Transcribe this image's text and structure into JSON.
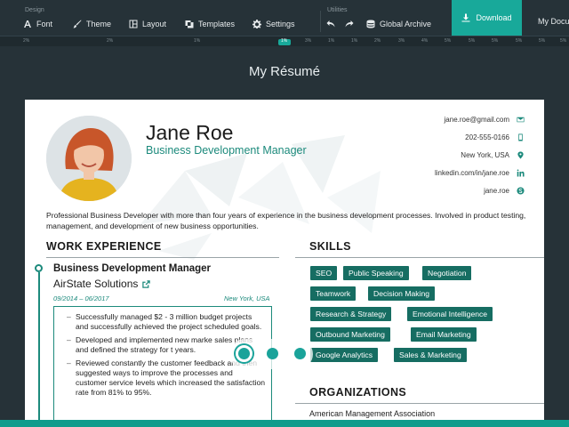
{
  "toolbar": {
    "design_label": "Design",
    "utilities_label": "Utilities",
    "font": "Font",
    "theme": "Theme",
    "layout": "Layout",
    "templates": "Templates",
    "settings": "Settings",
    "global_archive": "Global Archive",
    "download": "Download",
    "my_documents": "My Docu",
    "icons": [
      "font-icon",
      "theme-brush-icon",
      "layout-icon",
      "templates-icon",
      "settings-gear-icon",
      "undo-icon",
      "redo-icon",
      "archive-icon",
      "download-icon"
    ]
  },
  "ruler": {
    "ticks": [
      "2%",
      "2%",
      "1%",
      "1%",
      "3%",
      "1%",
      "1%",
      "2%",
      "3%",
      "4%",
      "5%",
      "5%",
      "5%",
      "5%",
      "5%",
      "5%",
      "5%",
      "5%",
      "5%",
      "5%"
    ],
    "active_index": 3
  },
  "page_title": "My Résumé",
  "resume": {
    "name": "Jane Roe",
    "role": "Business Development Manager",
    "contact": {
      "email": "jane.roe@gmail.com",
      "phone": "202-555-0166",
      "location": "New York, USA",
      "linkedin": "linkedin.com/in/jane.roe",
      "skype": "jane.roe"
    },
    "summary": "Professional Business Developer with more than four years of experience in the business development processes. Involved in product testing, management, and development of new business opportunities.",
    "work_title": "WORK EXPERIENCE",
    "job": {
      "title": "Business Development Manager",
      "company": "AirState Solutions",
      "dates": "09/2014 – 06/2017",
      "location": "New York, USA",
      "bullets": [
        "Successfully managed $2 - 3 million budget projects and successfully achieved the project scheduled goals.",
        "Developed and implemented new marke sales plans and defined the strategy for t years.",
        "Reviewed constantly the customer feedback and then suggested ways to improve the processes and customer service levels which increased the satisfaction rate from 81% to 95%."
      ]
    },
    "skills_title": "SKILLS",
    "skills": [
      "SEO",
      "Public Speaking",
      "Negotiation",
      "Teamwork",
      "Decision Making",
      "Research & Strategy",
      "Emotional Intelligence",
      "Outbound Marketing",
      "Email Marketing",
      "Google Analytics",
      "Sales & Marketing"
    ],
    "organizations_title": "ORGANIZATIONS",
    "organizations": [
      "American Management Association"
    ]
  },
  "carousel": {
    "count": 3,
    "active": 0
  },
  "colors": {
    "accent": "#1c8a7c",
    "skill_tag": "#166d62",
    "toolbar_bg": "#263238",
    "download_bg": "#18a99a"
  }
}
